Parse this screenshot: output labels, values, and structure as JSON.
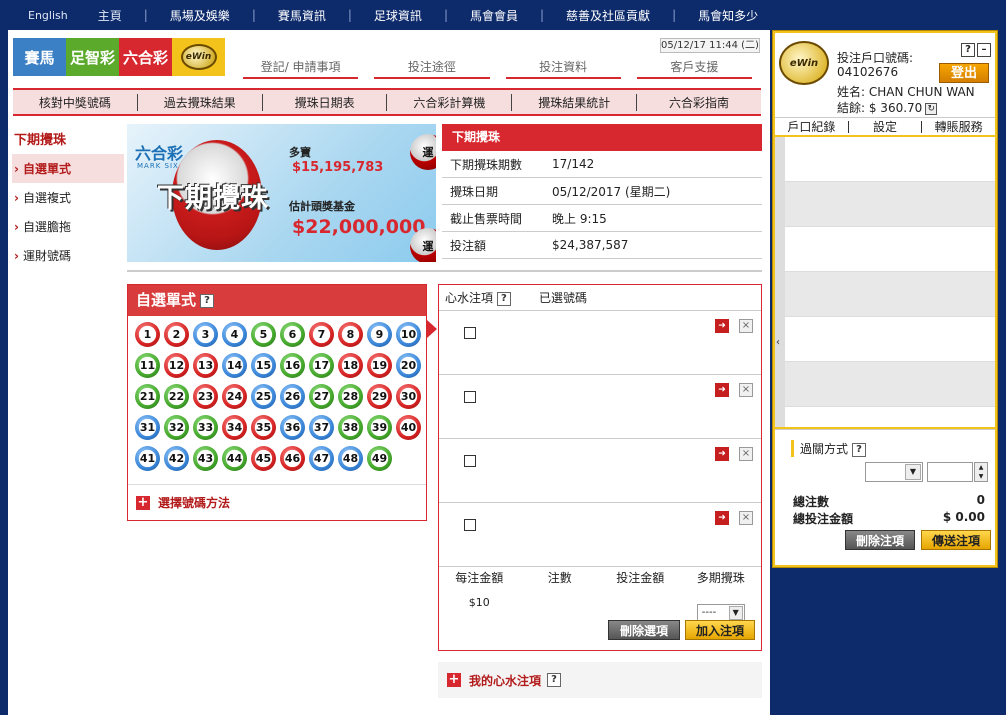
{
  "topnav": {
    "lang": "English",
    "home": "主頁",
    "items": [
      "馬場及娛樂",
      "賽馬資訊",
      "足球資訊",
      "馬會會員",
      "慈善及社區貢獻",
      "馬會知多少"
    ]
  },
  "logos": {
    "horse": "賽馬",
    "football": "足智彩",
    "marksix": "六合彩",
    "ewin": "eWin"
  },
  "datetime": "05/12/17 11:44 (二)",
  "sublinks": [
    "登記/ 申請事項",
    "投注途徑",
    "投注資料",
    "客戶支援"
  ],
  "redbar": [
    "核對中獎號碼",
    "過去攪珠結果",
    "攪珠日期表",
    "六合彩計算機",
    "攪珠結果統計",
    "六合彩指南"
  ],
  "leftmenu": {
    "head": "下期攪珠",
    "items": [
      "自選單式",
      "自選複式",
      "自選膽拖",
      "運財號碼"
    ]
  },
  "banner": {
    "logo": "六合彩",
    "logo_sub": "MARK SIX",
    "title": "下期攪珠",
    "label1": "多寶",
    "value1": "$15,195,783",
    "label2": "估計頭獎基金",
    "value2": "$22,000,000",
    "ball_text": "運"
  },
  "nextdraw": {
    "header": "下期攪珠",
    "rows": [
      {
        "k": "下期攪珠期數",
        "v": "17/142"
      },
      {
        "k": "攪珠日期",
        "v": "05/12/2017 (星期二)"
      },
      {
        "k": "截止售票時間",
        "v": "晚上 9:15"
      },
      {
        "k": "投注額",
        "v": "$24,387,587"
      }
    ]
  },
  "single": {
    "title": "自選單式",
    "help": "?",
    "balls": [
      1,
      2,
      3,
      4,
      5,
      6,
      7,
      8,
      9,
      10,
      11,
      12,
      13,
      14,
      15,
      16,
      17,
      18,
      19,
      20,
      21,
      22,
      23,
      24,
      25,
      26,
      27,
      28,
      29,
      30,
      31,
      32,
      33,
      34,
      35,
      36,
      37,
      38,
      39,
      40,
      41,
      42,
      43,
      44,
      45,
      46,
      47,
      48,
      49
    ],
    "ball_colors": [
      "red",
      "red",
      "blue",
      "blue",
      "green",
      "green",
      "red",
      "red",
      "blue",
      "blue",
      "green",
      "red",
      "red",
      "blue",
      "blue",
      "green",
      "green",
      "red",
      "red",
      "blue",
      "green",
      "green",
      "red",
      "red",
      "blue",
      "blue",
      "green",
      "green",
      "red",
      "red",
      "blue",
      "green",
      "green",
      "red",
      "red",
      "blue",
      "blue",
      "green",
      "green",
      "red",
      "blue",
      "blue",
      "green",
      "green",
      "red",
      "red",
      "blue",
      "blue",
      "green"
    ],
    "choose": "選擇號碼方法"
  },
  "betpanel": {
    "col1": "心水注項",
    "col2": "已選號碼",
    "help": "?",
    "slot_go": "➜",
    "slot_del": "×",
    "sum_headers": [
      "每注金額",
      "注數",
      "投注金額",
      "多期攪珠"
    ],
    "unit": "$10",
    "multi": "----",
    "clear": "刪除選項",
    "add": "加入注項"
  },
  "mybets": {
    "label": "我的心水注項",
    "help": "?"
  },
  "account": {
    "label_acct": "投注戶口號碼:",
    "acct_no": "04102676",
    "name": "姓名:  CHAN CHUN WAN",
    "balance": "結餘:  $ 360.70",
    "logout": "登出",
    "help": "?",
    "min": "–",
    "refresh": "↻",
    "ewin": "eWin"
  },
  "alinks": [
    "戶口紀錄",
    "設定",
    "轉賬服務"
  ],
  "slip": {
    "collapse": "‹"
  },
  "pass": {
    "title": "過關方式",
    "help": "?",
    "count_label": "總注數",
    "count_val": "0",
    "amount_label": "總投注金額",
    "amount_val": "$ 0.00",
    "delete": "刪除注項",
    "send": "傳送注項"
  }
}
